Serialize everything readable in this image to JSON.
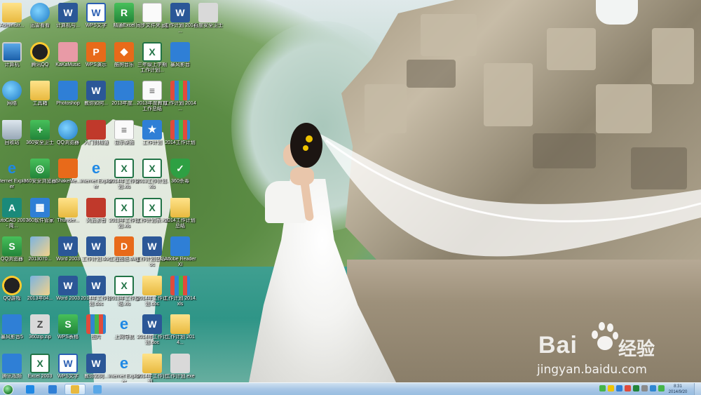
{
  "desktop_icons": [
    {
      "label": "Administr...",
      "kind": "k-folder",
      "glyph": ""
    },
    {
      "label": "计算机",
      "kind": "k-monitor",
      "glyph": ""
    },
    {
      "label": "网络",
      "kind": "k-globe",
      "glyph": ""
    },
    {
      "label": "回收站",
      "kind": "k-recycle",
      "glyph": ""
    },
    {
      "label": "Internet Explorer",
      "kind": "k-ie",
      "glyph": "e"
    },
    {
      "label": "AutoCAD 2007 - 简...",
      "kind": "k-teal",
      "glyph": "A"
    },
    {
      "label": "QQ浏览器",
      "kind": "k-green",
      "glyph": "S"
    },
    {
      "label": "QQ游戏",
      "kind": "k-qq",
      "glyph": ""
    },
    {
      "label": "暴风影音5",
      "kind": "k-blue",
      "glyph": ""
    },
    {
      "label": "腾讯视频",
      "kind": "k-blue",
      "glyph": ""
    },
    {
      "label": "迅雷看看",
      "kind": "k-globe",
      "glyph": ""
    },
    {
      "label": "腾讯QQ",
      "kind": "k-qq",
      "glyph": ""
    },
    {
      "label": "工具箱",
      "kind": "k-folder",
      "glyph": ""
    },
    {
      "label": "360安全卫士",
      "kind": "k-green",
      "glyph": "+"
    },
    {
      "label": "360安全浏览器",
      "kind": "k-green",
      "glyph": "◎"
    },
    {
      "label": "360软件管家",
      "kind": "k-blue",
      "glyph": "▦"
    },
    {
      "label": "2013070...",
      "kind": "k-pic",
      "glyph": ""
    },
    {
      "label": "2013年04...",
      "kind": "k-pic",
      "glyph": ""
    },
    {
      "label": "360zip.zip",
      "kind": "k-gray",
      "glyph": "Z"
    },
    {
      "label": "Excel 2003",
      "kind": "k-excel",
      "glyph": "X"
    },
    {
      "label": "计算机与...",
      "kind": "k-word",
      "glyph": "W"
    },
    {
      "label": "KaKaMusic",
      "kind": "k-pink",
      "glyph": ""
    },
    {
      "label": "Photoshop",
      "kind": "k-blue",
      "glyph": ""
    },
    {
      "label": "QQ浏览器",
      "kind": "k-globe",
      "glyph": ""
    },
    {
      "label": "ShakeMe...",
      "kind": "k-orange",
      "glyph": ""
    },
    {
      "label": "Thunder...",
      "kind": "k-folder",
      "glyph": ""
    },
    {
      "label": "Word 2003",
      "kind": "k-word",
      "glyph": "W"
    },
    {
      "label": "Word 2003",
      "kind": "k-word",
      "glyph": "W"
    },
    {
      "label": "WPS表格",
      "kind": "k-green",
      "glyph": "S"
    },
    {
      "label": "WPS文字",
      "kind": "k-wps",
      "glyph": "W"
    },
    {
      "label": "WPS文字",
      "kind": "k-wps",
      "glyph": "W"
    },
    {
      "label": "WPS演示",
      "kind": "k-orange",
      "glyph": "P"
    },
    {
      "label": "教你如何...",
      "kind": "k-word",
      "glyph": "W"
    },
    {
      "label": "入门到精通",
      "kind": "k-red",
      "glyph": ""
    },
    {
      "label": "Internet Explorer",
      "kind": "k-ie",
      "glyph": "e"
    },
    {
      "label": "风云影音",
      "kind": "k-red",
      "glyph": ""
    },
    {
      "label": "工作计划.doc",
      "kind": "k-word",
      "glyph": "W"
    },
    {
      "label": "2014年工作计划.doc",
      "kind": "k-word",
      "glyph": "W"
    },
    {
      "label": "图片",
      "kind": "k-books",
      "glyph": ""
    },
    {
      "label": "教你如何...",
      "kind": "k-word",
      "glyph": "W"
    },
    {
      "label": "精通Excel",
      "kind": "k-green",
      "glyph": "R"
    },
    {
      "label": "酷狗音乐",
      "kind": "k-orange",
      "glyph": "◆"
    },
    {
      "label": "2013年度...",
      "kind": "k-blue",
      "glyph": ""
    },
    {
      "label": "显示桌面",
      "kind": "k-doc",
      "glyph": "≡"
    },
    {
      "label": "2014年工作计划.xls",
      "kind": "k-excel",
      "glyph": "X"
    },
    {
      "label": "2013年工作计划.xls",
      "kind": "k-excel",
      "glyph": "X"
    },
    {
      "label": "工程图纸.dwg",
      "kind": "k-orange",
      "glyph": "D"
    },
    {
      "label": "2013年工作总结.xls",
      "kind": "k-excel",
      "glyph": "X"
    },
    {
      "label": "上网导航",
      "kind": "k-ie",
      "glyph": "e"
    },
    {
      "label": "Internet Explorer",
      "kind": "k-ie",
      "glyph": "e"
    },
    {
      "label": "同步文件夹.jpg",
      "kind": "k-doc",
      "glyph": ""
    },
    {
      "label": "三年级上学期工作计划...",
      "kind": "k-excel",
      "glyph": "X"
    },
    {
      "label": "2013年度教育工作总结",
      "kind": "k-doc",
      "glyph": "≡"
    },
    {
      "label": "工作计划",
      "kind": "k-blue",
      "glyph": "★"
    },
    {
      "label": "2013工作计划.xls",
      "kind": "k-excel",
      "glyph": "X"
    },
    {
      "label": "工作计划表.xls",
      "kind": "k-excel",
      "glyph": "X"
    },
    {
      "label": "工作计划总结.doc",
      "kind": "k-word",
      "glyph": "W"
    },
    {
      "label": "2014年工作计划.doc",
      "kind": "k-folder",
      "glyph": ""
    },
    {
      "label": "2014年工作计划.doc",
      "kind": "k-word",
      "glyph": "W"
    },
    {
      "label": "2014年工作计划...",
      "kind": "k-folder",
      "glyph": ""
    },
    {
      "label": "工作计划 2014 ...",
      "kind": "k-word",
      "glyph": "W"
    },
    {
      "label": "暴风影音",
      "kind": "k-blue",
      "glyph": ""
    },
    {
      "label": "工作计划 2014 ...",
      "kind": "k-books",
      "glyph": ""
    },
    {
      "label": "2014工作计划",
      "kind": "k-books",
      "glyph": ""
    },
    {
      "label": "360杀毒",
      "kind": "k-shield",
      "glyph": "✓"
    },
    {
      "label": "2014工作计划总结",
      "kind": "k-folder",
      "glyph": ""
    },
    {
      "label": "Adobe Reader XI",
      "kind": "k-blue",
      "glyph": ""
    },
    {
      "label": "工作计划 2014.xls",
      "kind": "k-books",
      "glyph": ""
    },
    {
      "label": "工作计划 2014...",
      "kind": "k-folder",
      "glyph": ""
    },
    {
      "label": "工作计划.exe",
      "kind": "k-gray",
      "glyph": ""
    },
    {
      "label": "百度安全卫士",
      "kind": "k-gray",
      "glyph": ""
    }
  ],
  "taskbar": {
    "buttons": [
      {
        "name": "ie",
        "color": "#1e88e5"
      },
      {
        "name": "browser",
        "color": "#2f7fd6"
      },
      {
        "name": "explorer",
        "color": "#e8b93f"
      },
      {
        "name": "window",
        "color": "#5aa8e8"
      }
    ],
    "tray_colors": [
      "#45b549",
      "#f0c400",
      "#2f7fd6",
      "#e04b3c",
      "#23853a",
      "#8a8a8a",
      "#2f86d1",
      "#45b549"
    ],
    "clock_time": "8:31",
    "clock_date": "2014/9/20"
  },
  "watermark": {
    "brand": "Bai",
    "brand_suffix": "经验",
    "url": "jingyan.baidu.com"
  }
}
